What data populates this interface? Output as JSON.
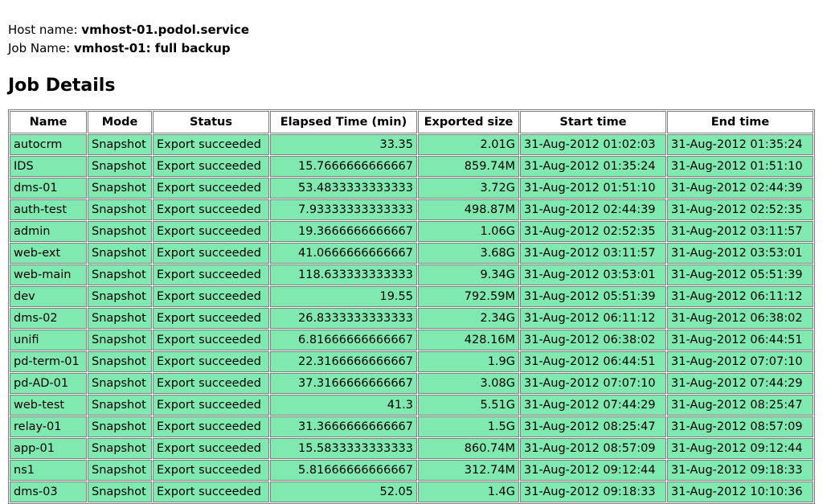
{
  "header": {
    "host_label": "Host name:",
    "host_value": "vmhost-01.podol.service",
    "job_label": "Job Name:",
    "job_value": "vmhost-01: full backup"
  },
  "section": {
    "title": "Job Details"
  },
  "theme": {
    "row_background": "#7fe9b0",
    "header_background": "#ffffff",
    "border_color": "#808080",
    "page_background": "#ffffff",
    "text_color": "#000000"
  },
  "table": {
    "columns": [
      {
        "key": "name",
        "label": "Name",
        "align": "left"
      },
      {
        "key": "mode",
        "label": "Mode",
        "align": "left"
      },
      {
        "key": "status",
        "label": "Status",
        "align": "left"
      },
      {
        "key": "elapsed",
        "label": "Elapsed Time (min)",
        "align": "right"
      },
      {
        "key": "size",
        "label": "Exported size",
        "align": "right"
      },
      {
        "key": "start",
        "label": "Start time",
        "align": "left"
      },
      {
        "key": "end",
        "label": "End time",
        "align": "left"
      }
    ],
    "rows": [
      {
        "name": "autocrm",
        "mode": "Snapshot",
        "status": "Export succeeded",
        "elapsed": "33.35",
        "size": "2.01G",
        "start": "31-Aug-2012 01:02:03",
        "end": "31-Aug-2012 01:35:24"
      },
      {
        "name": "IDS",
        "mode": "Snapshot",
        "status": "Export succeeded",
        "elapsed": "15.7666666666667",
        "size": "859.74M",
        "start": "31-Aug-2012 01:35:24",
        "end": "31-Aug-2012 01:51:10"
      },
      {
        "name": "dms-01",
        "mode": "Snapshot",
        "status": "Export succeeded",
        "elapsed": "53.4833333333333",
        "size": "3.72G",
        "start": "31-Aug-2012 01:51:10",
        "end": "31-Aug-2012 02:44:39"
      },
      {
        "name": "auth-test",
        "mode": "Snapshot",
        "status": "Export succeeded",
        "elapsed": "7.93333333333333",
        "size": "498.87M",
        "start": "31-Aug-2012 02:44:39",
        "end": "31-Aug-2012 02:52:35"
      },
      {
        "name": "admin",
        "mode": "Snapshot",
        "status": "Export succeeded",
        "elapsed": "19.3666666666667",
        "size": "1.06G",
        "start": "31-Aug-2012 02:52:35",
        "end": "31-Aug-2012 03:11:57"
      },
      {
        "name": "web-ext",
        "mode": "Snapshot",
        "status": "Export succeeded",
        "elapsed": "41.0666666666667",
        "size": "3.68G",
        "start": "31-Aug-2012 03:11:57",
        "end": "31-Aug-2012 03:53:01"
      },
      {
        "name": "web-main",
        "mode": "Snapshot",
        "status": "Export succeeded",
        "elapsed": "118.633333333333",
        "size": "9.34G",
        "start": "31-Aug-2012 03:53:01",
        "end": "31-Aug-2012 05:51:39"
      },
      {
        "name": "dev",
        "mode": "Snapshot",
        "status": "Export succeeded",
        "elapsed": "19.55",
        "size": "792.59M",
        "start": "31-Aug-2012 05:51:39",
        "end": "31-Aug-2012 06:11:12"
      },
      {
        "name": "dms-02",
        "mode": "Snapshot",
        "status": "Export succeeded",
        "elapsed": "26.8333333333333",
        "size": "2.34G",
        "start": "31-Aug-2012 06:11:12",
        "end": "31-Aug-2012 06:38:02"
      },
      {
        "name": "unifi",
        "mode": "Snapshot",
        "status": "Export succeeded",
        "elapsed": "6.81666666666667",
        "size": "428.16M",
        "start": "31-Aug-2012 06:38:02",
        "end": "31-Aug-2012 06:44:51"
      },
      {
        "name": "pd-term-01",
        "mode": "Snapshot",
        "status": "Export succeeded",
        "elapsed": "22.3166666666667",
        "size": "1.9G",
        "start": "31-Aug-2012 06:44:51",
        "end": "31-Aug-2012 07:07:10"
      },
      {
        "name": "pd-AD-01",
        "mode": "Snapshot",
        "status": "Export succeeded",
        "elapsed": "37.3166666666667",
        "size": "3.08G",
        "start": "31-Aug-2012 07:07:10",
        "end": "31-Aug-2012 07:44:29"
      },
      {
        "name": "web-test",
        "mode": "Snapshot",
        "status": "Export succeeded",
        "elapsed": "41.3",
        "size": "5.51G",
        "start": "31-Aug-2012 07:44:29",
        "end": "31-Aug-2012 08:25:47"
      },
      {
        "name": "relay-01",
        "mode": "Snapshot",
        "status": "Export succeeded",
        "elapsed": "31.3666666666667",
        "size": "1.5G",
        "start": "31-Aug-2012 08:25:47",
        "end": "31-Aug-2012 08:57:09"
      },
      {
        "name": "app-01",
        "mode": "Snapshot",
        "status": "Export succeeded",
        "elapsed": "15.5833333333333",
        "size": "860.74M",
        "start": "31-Aug-2012 08:57:09",
        "end": "31-Aug-2012 09:12:44"
      },
      {
        "name": "ns1",
        "mode": "Snapshot",
        "status": "Export succeeded",
        "elapsed": "5.81666666666667",
        "size": "312.74M",
        "start": "31-Aug-2012 09:12:44",
        "end": "31-Aug-2012 09:18:33"
      },
      {
        "name": "dms-03",
        "mode": "Snapshot",
        "status": "Export succeeded",
        "elapsed": "52.05",
        "size": "1.4G",
        "start": "31-Aug-2012 09:18:33",
        "end": "31-Aug-2012 10:10:36"
      }
    ]
  }
}
